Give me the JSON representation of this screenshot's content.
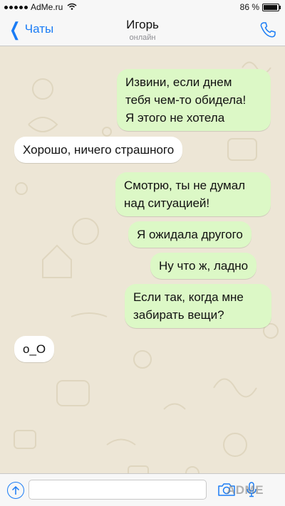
{
  "status_bar": {
    "carrier": "AdMe.ru",
    "battery_text": "86 %",
    "battery_level": 0.86,
    "signal_icon": "signal-dots-icon",
    "wifi_icon": "wifi-icon"
  },
  "nav": {
    "back_label": "Чаты",
    "contact_name": "Игорь",
    "contact_status": "онлайн",
    "accent_color": "#1a7cf5"
  },
  "chat": {
    "outgoing_color": "#dcf8c6",
    "incoming_color": "#ffffff",
    "messages": [
      {
        "direction": "outgoing",
        "text": "Извини, если днем\nтебя чем-то обидела!\nЯ этого не хотела"
      },
      {
        "direction": "incoming",
        "text": "Хорошо, ничего страшного"
      },
      {
        "direction": "outgoing",
        "text": "Смотрю, ты не думал\nнад ситуацией!"
      },
      {
        "direction": "outgoing",
        "text": "Я ожидала другого"
      },
      {
        "direction": "outgoing",
        "text": "Ну что ж, ладно"
      },
      {
        "direction": "outgoing",
        "text": "Если так, когда мне\nзабирать вещи?"
      },
      {
        "direction": "incoming",
        "text": "o_O"
      }
    ]
  },
  "input_bar": {
    "message_value": "",
    "placeholder": "",
    "watermark": "ADME"
  }
}
